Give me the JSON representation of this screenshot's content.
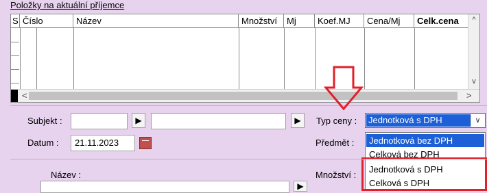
{
  "section_title": "Položky na aktuální příjemce",
  "grid": {
    "columns": [
      "S",
      "Číslo",
      "Název",
      "Množství",
      "Mj",
      "Koef.MJ",
      "Cena/Mj",
      "Celk.cena"
    ],
    "scroll_up": "^",
    "scroll_down": "v",
    "scroll_left": "<",
    "scroll_right": ">"
  },
  "form": {
    "subjekt_label": "Subjekt :",
    "datum_label": "Datum :",
    "datum_value": "21.11.2023",
    "typ_ceny_label": "Typ ceny :",
    "predmet_label": "Předmět :",
    "nazev_label": "Název :",
    "mnozstvi_label": "Množství :",
    "play_glyph": "▶"
  },
  "price_type": {
    "selected": "Jednotková s DPH",
    "options": [
      "Jednotková bez DPH",
      "Celková bez DPH",
      "Jednotková s DPH",
      "Celková s DPH"
    ],
    "highlighted_index": 0
  },
  "colors": {
    "background": "#e8d3ef",
    "selection": "#1c5fd6",
    "annotation": "#e0202a"
  }
}
